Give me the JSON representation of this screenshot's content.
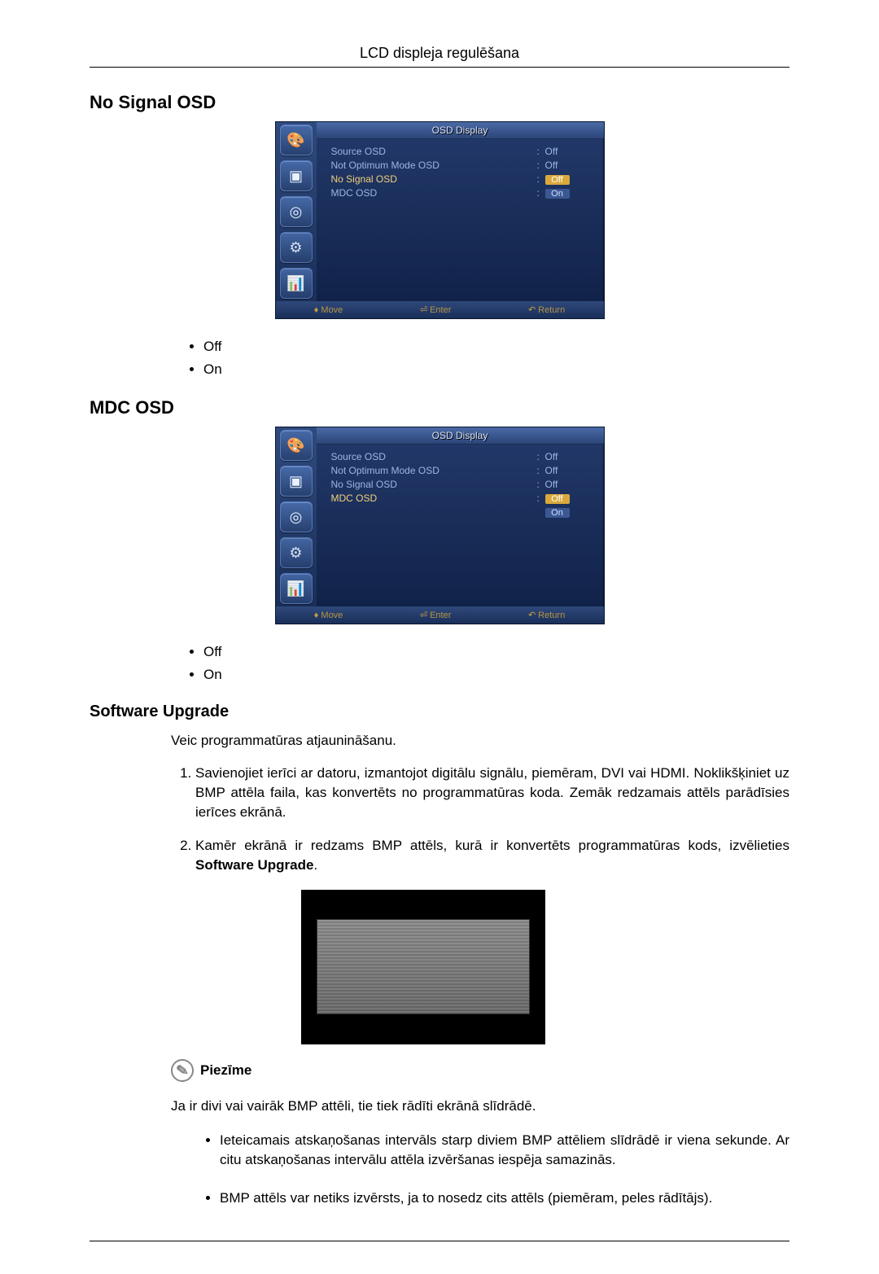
{
  "header": {
    "title": "LCD displeja regulēšana"
  },
  "headings": {
    "no_signal": "No Signal OSD",
    "mdc_osd": "MDC OSD",
    "software_upgrade": "Software Upgrade"
  },
  "bullets": {
    "off": "Off",
    "on": "On"
  },
  "osd1": {
    "title": "OSD Display",
    "rows": [
      {
        "label": "Source OSD",
        "value": "Off",
        "highlight": false
      },
      {
        "label": "Not Optimum Mode OSD",
        "value": "Off",
        "highlight": false
      },
      {
        "label": "No Signal OSD",
        "value": "Off",
        "highlight": true,
        "pill": true
      },
      {
        "label": "MDC OSD",
        "value": "On",
        "highlight": false,
        "pill": true,
        "below": true
      }
    ],
    "footer": {
      "move": "Move",
      "enter": "Enter",
      "return": "Return"
    }
  },
  "osd2": {
    "title": "OSD Display",
    "rows": [
      {
        "label": "Source OSD",
        "value": "Off",
        "highlight": false
      },
      {
        "label": "Not Optimum Mode OSD",
        "value": "Off",
        "highlight": false
      },
      {
        "label": "No Signal OSD",
        "value": "Off",
        "highlight": false
      },
      {
        "label": "MDC OSD",
        "value": "Off",
        "highlight": true,
        "pill": true
      },
      {
        "label": "",
        "value": "On",
        "highlight": false,
        "pill": true,
        "below": true
      }
    ],
    "footer": {
      "move": "Move",
      "enter": "Enter",
      "return": "Return"
    }
  },
  "software": {
    "intro": "Veic programmatūras atjaunināšanu.",
    "step1": "Savienojiet ierīci ar datoru, izmantojot digitālu signālu, piemēram, DVI vai HDMI. Noklikšķiniet uz BMP attēla faila, kas konvertēts no programmatūras koda. Zemāk redzamais attēls parādīsies ierīces ekrānā.",
    "step2_a": "Kamēr ekrānā ir redzams BMP attēls, kurā ir konvertēts programmatūras kods, izvēlieties ",
    "step2_b": "Software Upgrade",
    "step2_c": ".",
    "note_label": "Piezīme",
    "note_para": "Ja ir divi vai vairāk BMP attēli, tie tiek rādīti ekrānā slīdrādē.",
    "note_b1": "Ieteicamais atskaņošanas intervāls starp diviem BMP attēliem slīdrādē ir viena sekunde. Ar citu atskaņošanas intervālu attēla izvēršanas iespēja samazinās.",
    "note_b2": "BMP attēls var netiks izvērsts, ja to nosedz cits attēls (piemēram, peles rādītājs)."
  },
  "icons": {
    "i1": "paint-icon",
    "i2": "adjust-icon",
    "i3": "circle-icon",
    "i4": "gear-icon",
    "i5": "chart-icon"
  }
}
